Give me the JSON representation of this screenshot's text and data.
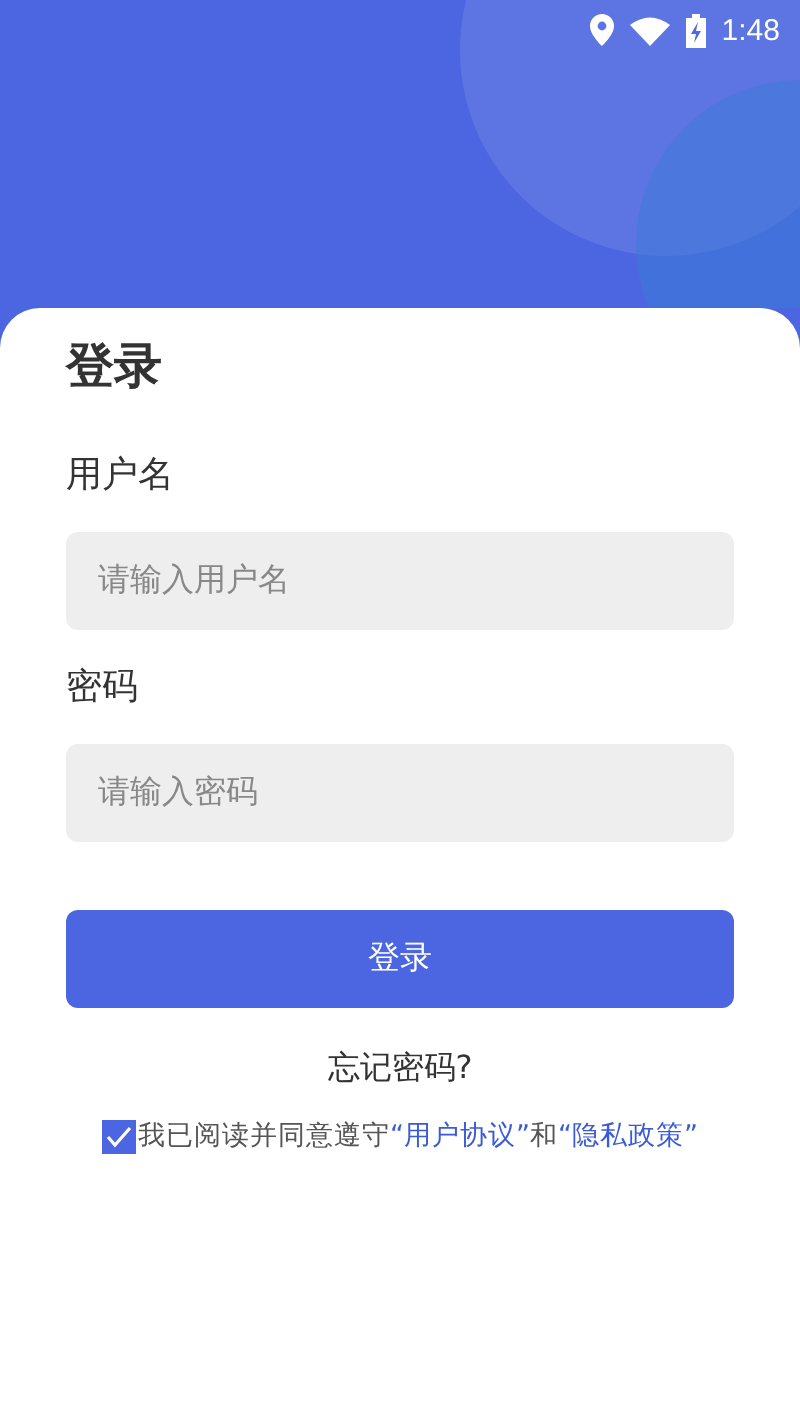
{
  "status_bar": {
    "time": "1:48"
  },
  "title": "登录",
  "fields": [
    {
      "label": "用户名",
      "placeholder": "请输入用户名"
    },
    {
      "label": "密码",
      "placeholder": "请输入密码"
    }
  ],
  "login_button": "登录",
  "forgot_link": "忘记密码?",
  "agreement": {
    "checked": true,
    "text": "我已阅读并同意遵守",
    "link_1": "“用户协议”",
    "joiner": "和",
    "link_2": "“隐私政策”"
  }
}
